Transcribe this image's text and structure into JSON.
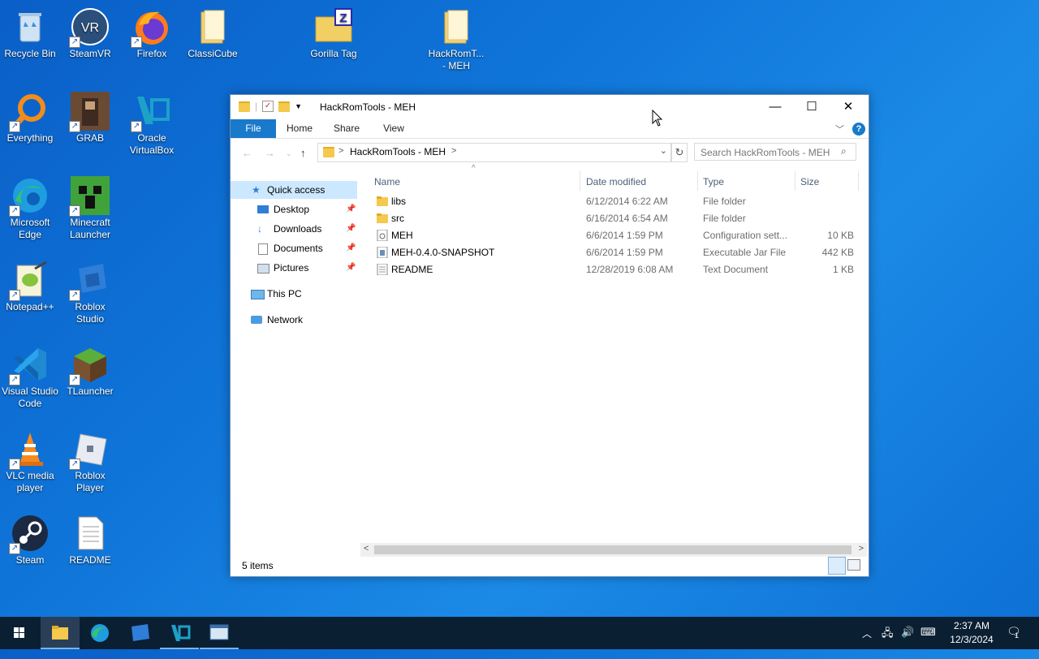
{
  "desktop": {
    "icons": [
      {
        "label": "Recycle Bin",
        "glyph": "🗑"
      },
      {
        "label": "SteamVR",
        "glyph": "VR"
      },
      {
        "label": "Firefox",
        "glyph": "🦊"
      },
      {
        "label": "ClassiCube",
        "glyph": ""
      },
      {
        "label": "Gorilla Tag",
        "glyph": "Z"
      },
      {
        "label": "HackRomT... - MEH",
        "glyph": ""
      },
      {
        "label": "Everything",
        "glyph": "🔍"
      },
      {
        "label": "GRAB",
        "glyph": ""
      },
      {
        "label": "Oracle VirtualBox",
        "glyph": "V"
      },
      {
        "label": "Microsoft Edge",
        "glyph": ""
      },
      {
        "label": "Minecraft Launcher",
        "glyph": ""
      },
      {
        "label": "Notepad++",
        "glyph": ""
      },
      {
        "label": "Roblox Studio",
        "glyph": ""
      },
      {
        "label": "Visual Studio Code",
        "glyph": ""
      },
      {
        "label": "TLauncher",
        "glyph": ""
      },
      {
        "label": "VLC media player",
        "glyph": ""
      },
      {
        "label": "Roblox Player",
        "glyph": ""
      },
      {
        "label": "Steam",
        "glyph": ""
      },
      {
        "label": "README",
        "glyph": ""
      }
    ]
  },
  "window": {
    "title": "HackRomTools - MEH",
    "minimize": "—",
    "maximize": "☐",
    "close": "✕",
    "ribbon_tabs": [
      "File",
      "Home",
      "Share",
      "View"
    ],
    "help": "?",
    "address": {
      "separator": ">",
      "path": "HackRomTools - MEH",
      "end": ">"
    },
    "search_placeholder": "Search HackRomTools - MEH",
    "sidebar": {
      "quick_access": "Quick access",
      "items": [
        "Desktop",
        "Downloads",
        "Documents",
        "Pictures"
      ],
      "this_pc": "This PC",
      "network": "Network"
    },
    "columns": [
      "Name",
      "Date modified",
      "Type",
      "Size"
    ],
    "files": [
      {
        "name": "libs",
        "date": "6/12/2014 6:22 AM",
        "type": "File folder",
        "size": "",
        "kind": "folder"
      },
      {
        "name": "src",
        "date": "6/16/2014 6:54 AM",
        "type": "File folder",
        "size": "",
        "kind": "folder"
      },
      {
        "name": "MEH",
        "date": "6/6/2014 1:59 PM",
        "type": "Configuration sett...",
        "size": "10 KB",
        "kind": "config"
      },
      {
        "name": "MEH-0.4.0-SNAPSHOT",
        "date": "6/6/2014 1:59 PM",
        "type": "Executable Jar File",
        "size": "442 KB",
        "kind": "jar"
      },
      {
        "name": "README",
        "date": "12/28/2019 6:08 AM",
        "type": "Text Document",
        "size": "1 KB",
        "kind": "text"
      }
    ],
    "status": "5 items"
  },
  "taskbar": {
    "time": "2:37 AM",
    "date": "12/3/2024",
    "notifications": "1"
  }
}
